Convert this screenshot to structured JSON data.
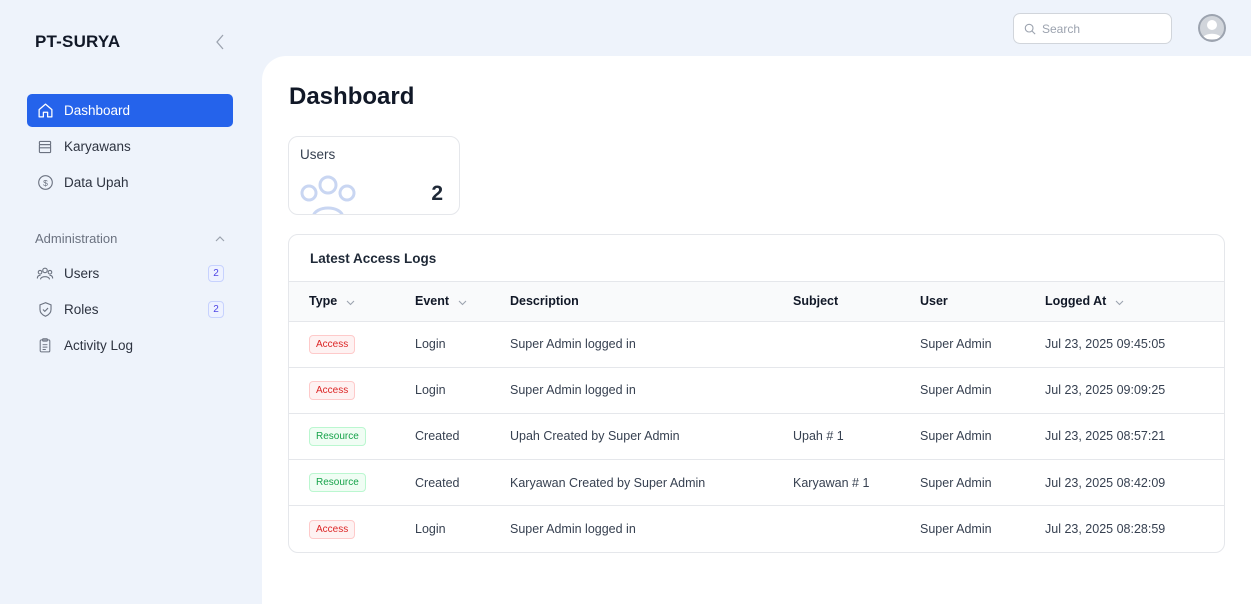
{
  "brand": "PT-SURYA",
  "search": {
    "placeholder": "Search"
  },
  "sidebar": {
    "items": [
      {
        "label": "Dashboard",
        "icon": "home-icon",
        "active": true
      },
      {
        "label": "Karyawans",
        "icon": "archive-icon"
      },
      {
        "label": "Data Upah",
        "icon": "dollar-icon"
      }
    ],
    "group": {
      "title": "Administration",
      "items": [
        {
          "label": "Users",
          "icon": "users-icon",
          "badge": "2"
        },
        {
          "label": "Roles",
          "icon": "shield-check-icon",
          "badge": "2"
        },
        {
          "label": "Activity Log",
          "icon": "clipboard-icon"
        }
      ]
    }
  },
  "page": {
    "title": "Dashboard"
  },
  "stats": {
    "users_label": "Users",
    "users_value": "2"
  },
  "logs": {
    "title": "Latest Access Logs",
    "columns": [
      "Type",
      "Event",
      "Description",
      "Subject",
      "User",
      "Logged At"
    ],
    "rows": [
      {
        "type": "Access",
        "event": "Login",
        "description": "Super Admin logged in",
        "subject": "",
        "user": "Super Admin",
        "logged_at": "Jul 23, 2025 09:45:05"
      },
      {
        "type": "Access",
        "event": "Login",
        "description": "Super Admin logged in",
        "subject": "",
        "user": "Super Admin",
        "logged_at": "Jul 23, 2025 09:09:25"
      },
      {
        "type": "Resource",
        "event": "Created",
        "description": "Upah Created by Super Admin",
        "subject": "Upah # 1",
        "user": "Super Admin",
        "logged_at": "Jul 23, 2025 08:57:21"
      },
      {
        "type": "Resource",
        "event": "Created",
        "description": "Karyawan Created by Super Admin",
        "subject": "Karyawan # 1",
        "user": "Super Admin",
        "logged_at": "Jul 23, 2025 08:42:09"
      },
      {
        "type": "Access",
        "event": "Login",
        "description": "Super Admin logged in",
        "subject": "",
        "user": "Super Admin",
        "logged_at": "Jul 23, 2025 08:28:59"
      }
    ]
  },
  "colors": {
    "primary": "#2563eb",
    "access_tag": "#dc2626",
    "resource_tag": "#16a34a",
    "background": "#eef3fb"
  }
}
